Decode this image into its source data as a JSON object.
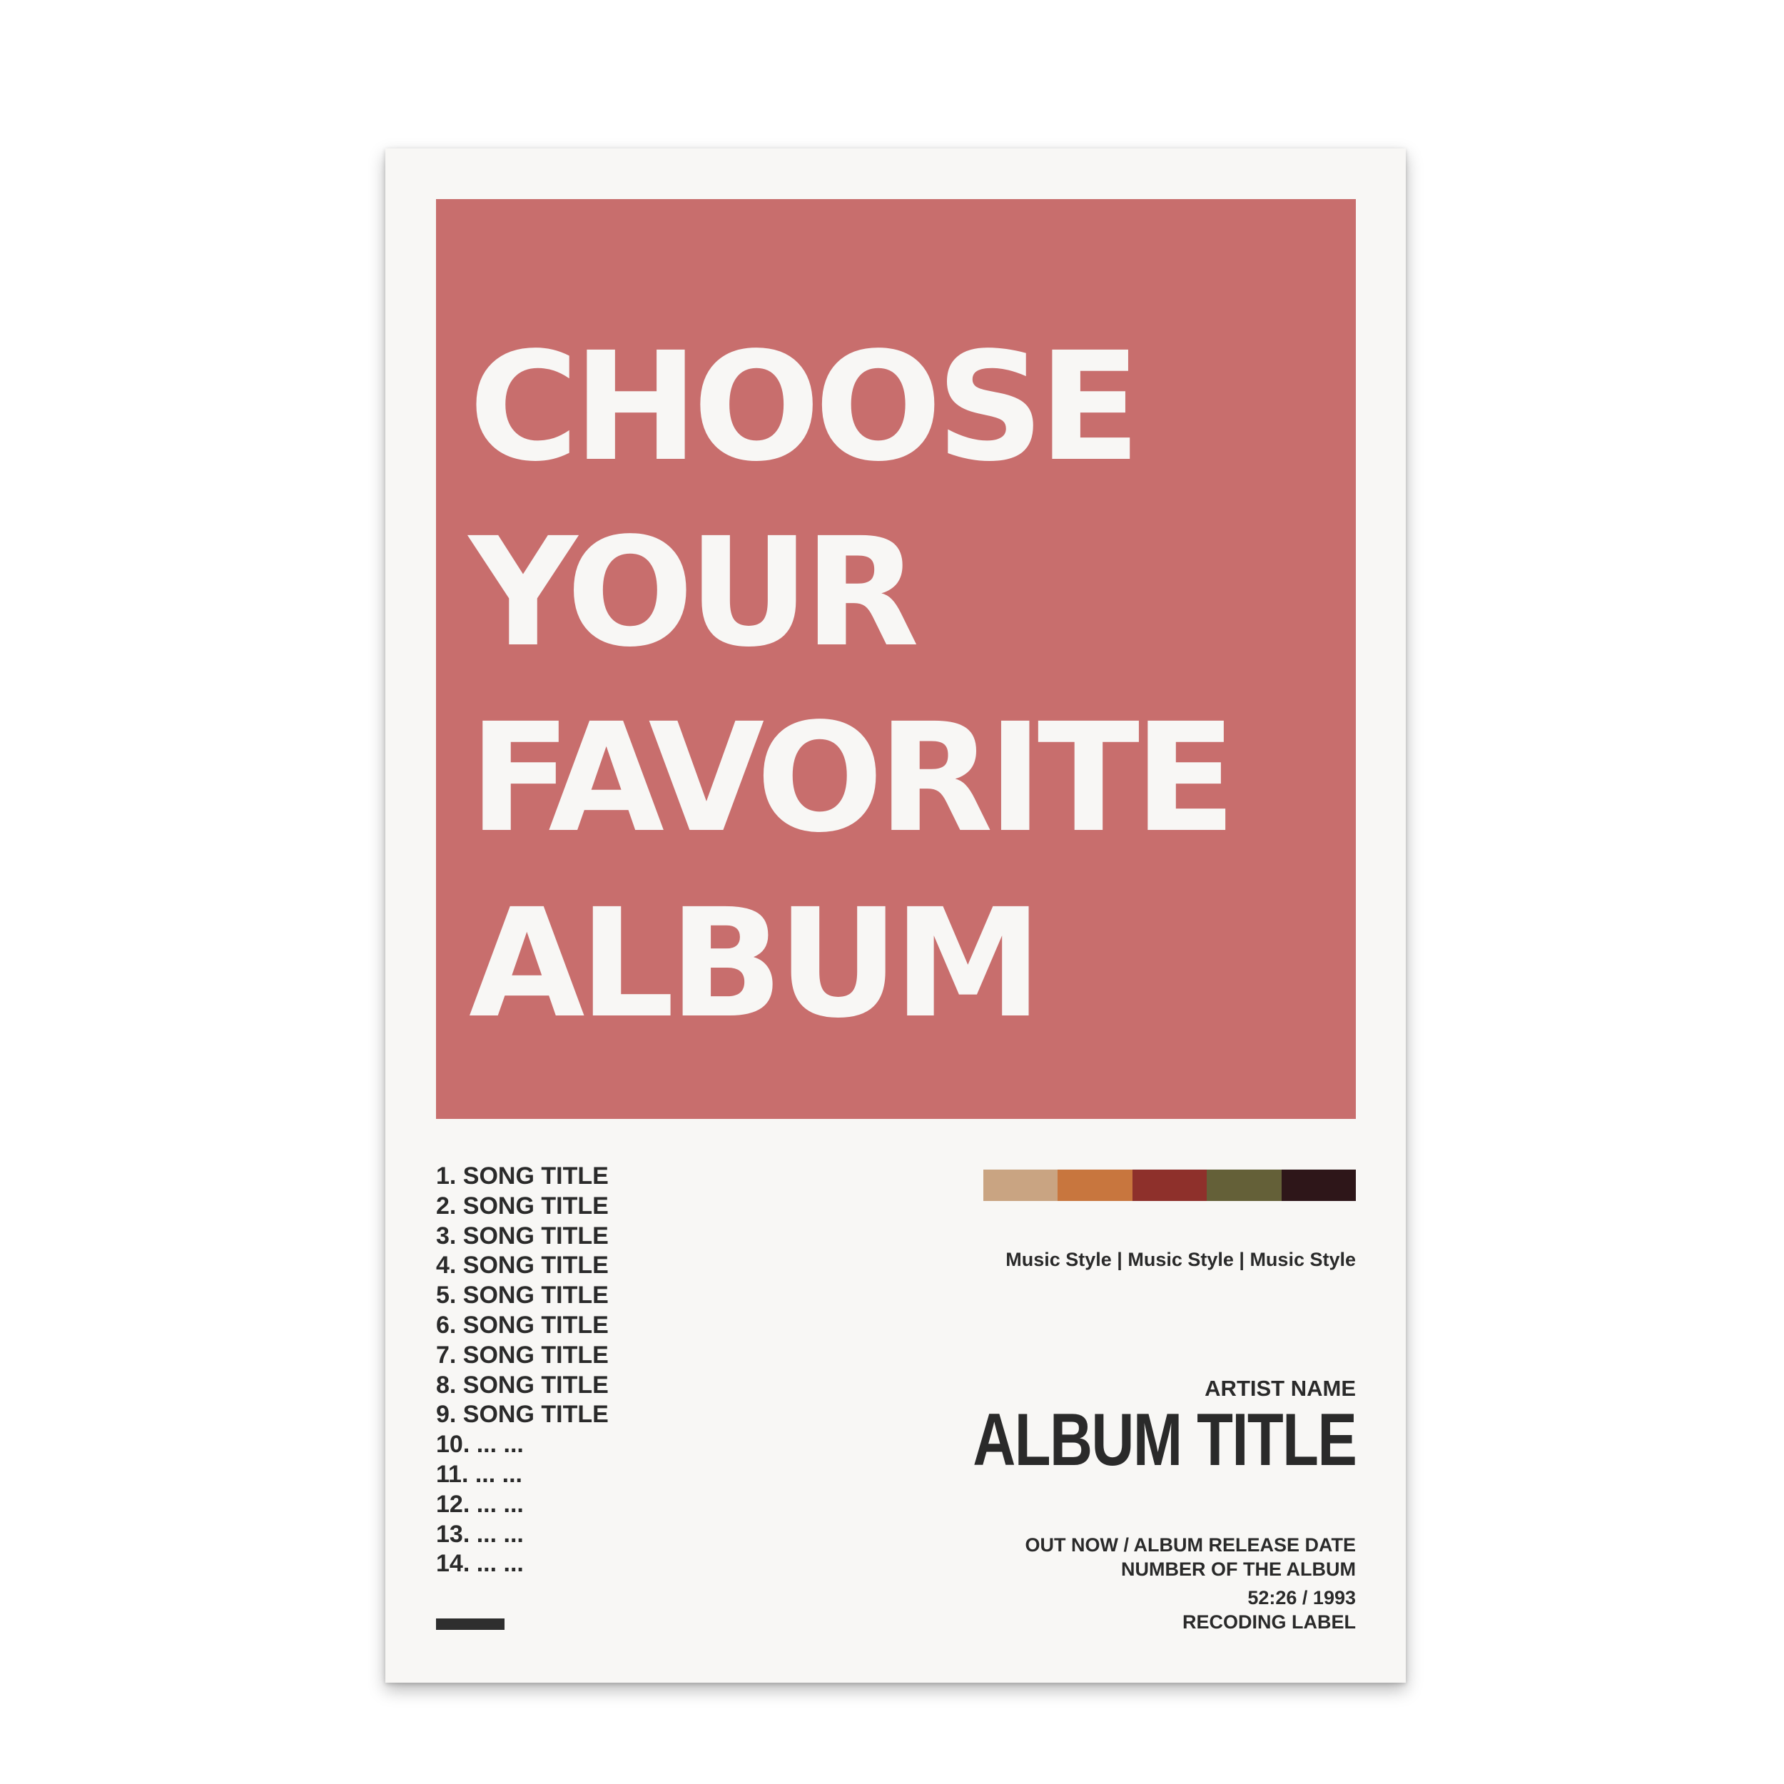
{
  "cover": {
    "headline_lines": [
      "CHOOSE",
      "YOUR",
      "FAVORITE",
      "ALBUM"
    ],
    "background_color": "#c86e6d"
  },
  "tracks": [
    "1. SONG TITLE",
    "2. SONG TITLE",
    "3. SONG TITLE",
    "4. SONG TITLE",
    "5. SONG TITLE",
    "6. SONG TITLE",
    "7. SONG TITLE",
    "8. SONG TITLE",
    "9. SONG TITLE",
    "10. ... ...",
    "11. ... ...",
    "12. ... ...",
    "13. ... ...",
    "14. ... ..."
  ],
  "palette": [
    "#c9a482",
    "#c8763e",
    "#8e302b",
    "#646038",
    "#2e1619"
  ],
  "music_styles": "Music Style | Music Style | Music Style",
  "artist_name": "ARTIST NAME",
  "album_title": "ALBUM TITLE",
  "info": {
    "release": "OUT NOW / ALBUM RELEASE DATE",
    "number": "NUMBER OF THE ALBUM",
    "length_year": "52:26 / 1993",
    "label": "RECODING LABEL"
  }
}
